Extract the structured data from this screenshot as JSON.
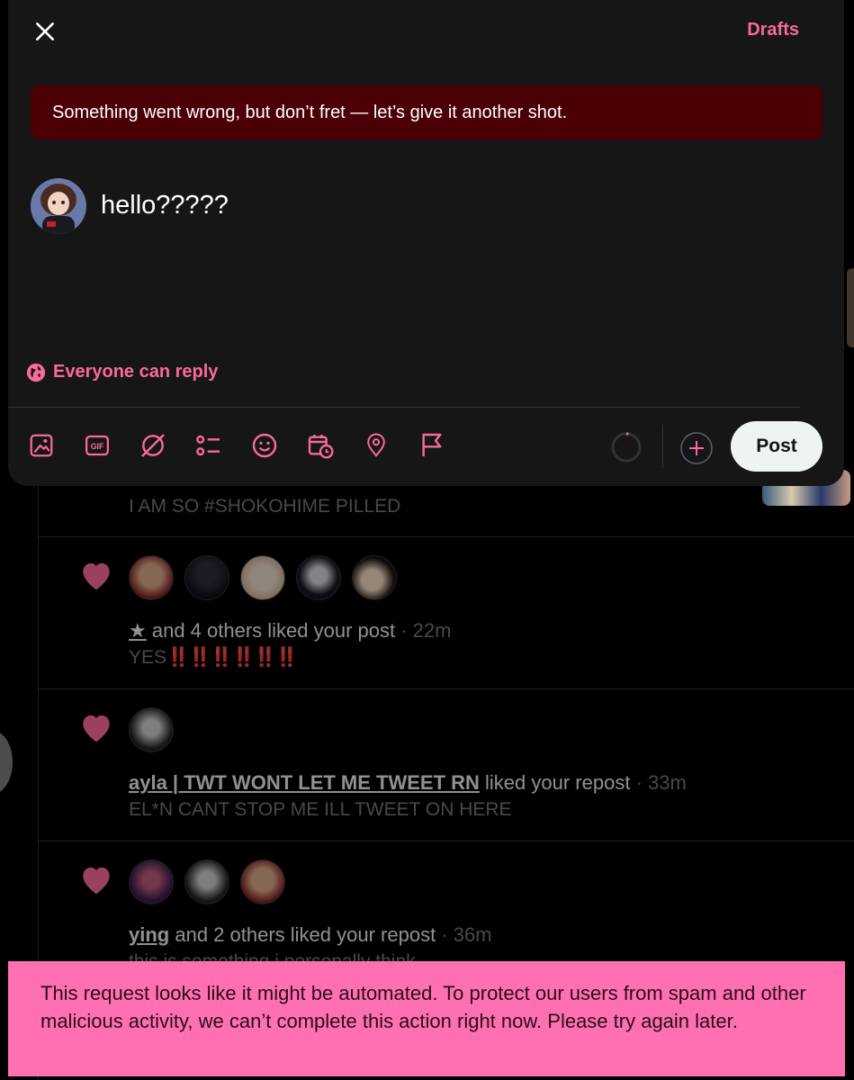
{
  "composer": {
    "drafts_label": "Drafts",
    "error_message": "Something went wrong, but don’t fret — let’s give it another shot.",
    "post_text": "hello?????",
    "reply_setting": "Everyone can reply",
    "post_button": "Post",
    "toolbar_icons": [
      "image-icon",
      "gif-icon",
      "grok-icon",
      "poll-icon",
      "emoji-icon",
      "schedule-icon",
      "location-icon",
      "flag-icon"
    ],
    "accent_color": "#f9699c"
  },
  "feed": {
    "items": [
      {
        "text": "I AM SO #SHOKOHIME PILLED"
      },
      {
        "user": "★",
        "action": " and 4 others liked your post",
        "time": " · 22m",
        "text": "YES",
        "exclaims": "‼️‼️‼️‼️‼️‼️"
      },
      {
        "user": "ayla | TWT WONT LET ME TWEET RN",
        "action": " liked your repost",
        "time": " · 33m",
        "text": "EL*N CANT STOP ME ILL TWEET ON HERE"
      },
      {
        "user": "ying",
        "action": " and 2 others liked your repost",
        "time": " · 36m",
        "text": "this is something i personally think"
      }
    ]
  },
  "toast": {
    "message": "This request looks like it might be automated. To protect our users from spam and other malicious activity, we can’t complete this action right now. Please try again later."
  }
}
